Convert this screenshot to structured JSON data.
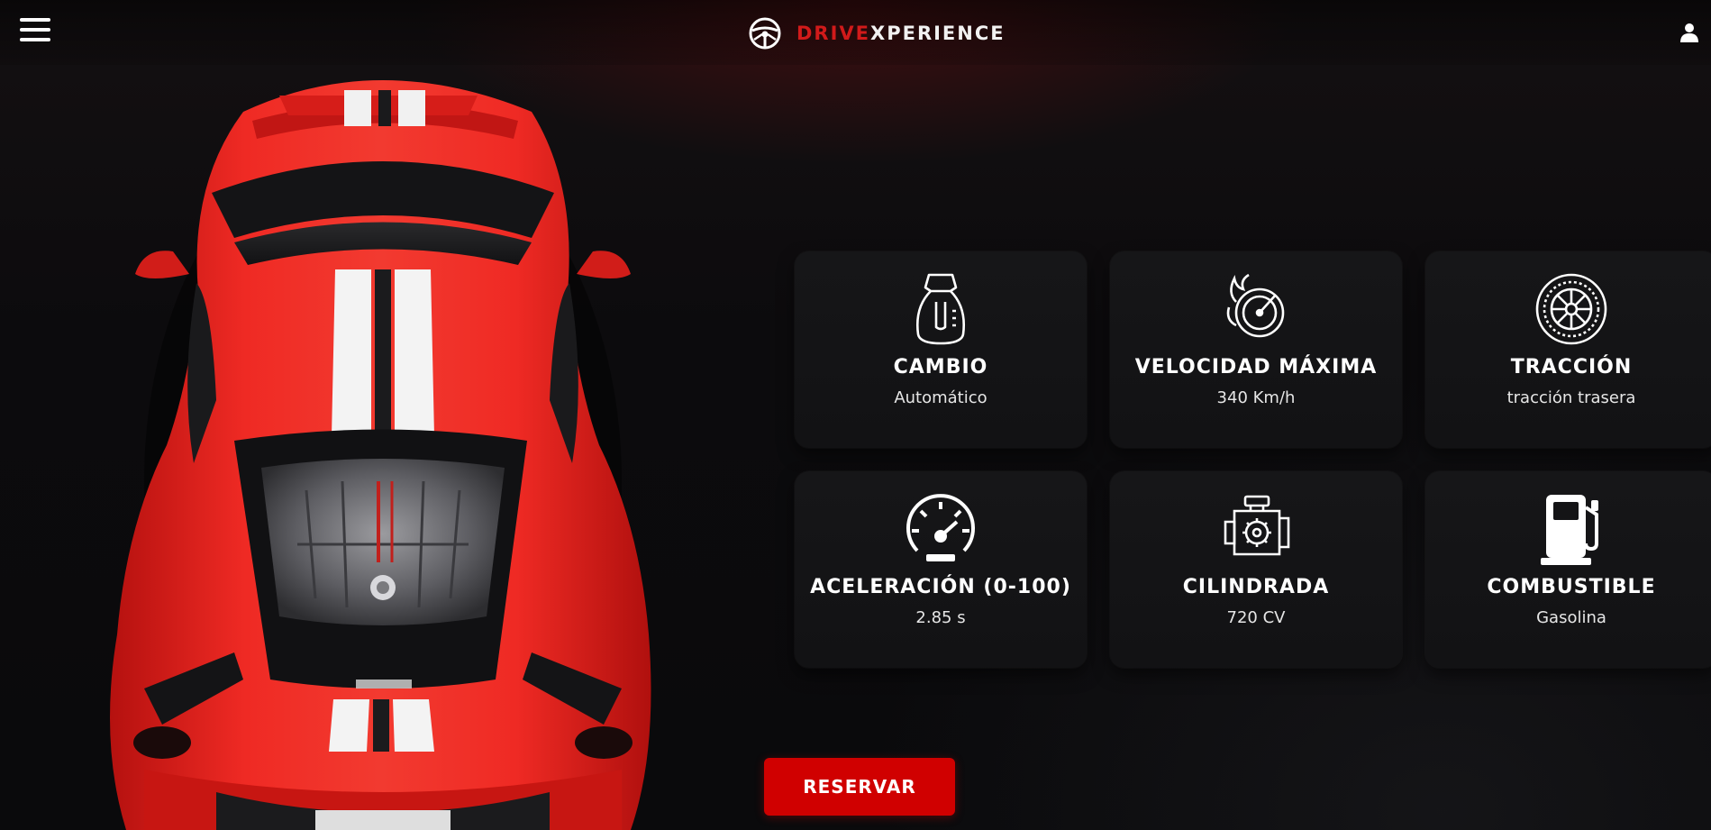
{
  "header": {
    "brand_part1": "DRIVE",
    "brand_part2": "XPERIENCE",
    "menu_icon": "hamburger-menu-icon",
    "logo_icon": "steering-wheel-icon",
    "account_icon": "user-icon"
  },
  "specs": [
    {
      "label": "CAMBIO",
      "value": "Automático",
      "icon": "gear-shift-icon"
    },
    {
      "label": "VELOCIDAD MÁXIMA",
      "value": "340 Km/h",
      "icon": "speed-flame-icon"
    },
    {
      "label": "TRACCIÓN",
      "value": "tracción trasera",
      "icon": "wheel-icon"
    },
    {
      "label": "ACELERACIÓN (0-100)",
      "value": "2.85 s",
      "icon": "speedometer-icon"
    },
    {
      "label": "CILINDRADA",
      "value": "720 CV",
      "icon": "engine-icon"
    },
    {
      "label": "COMBUSTIBLE",
      "value": "Gasolina",
      "icon": "fuel-pump-icon"
    }
  ],
  "actions": {
    "reserve_label": "RESERVAR"
  },
  "colors": {
    "accent": "#d00000",
    "background": "#0b0b0d",
    "card": "#141416",
    "car_red": "#e8211f"
  }
}
